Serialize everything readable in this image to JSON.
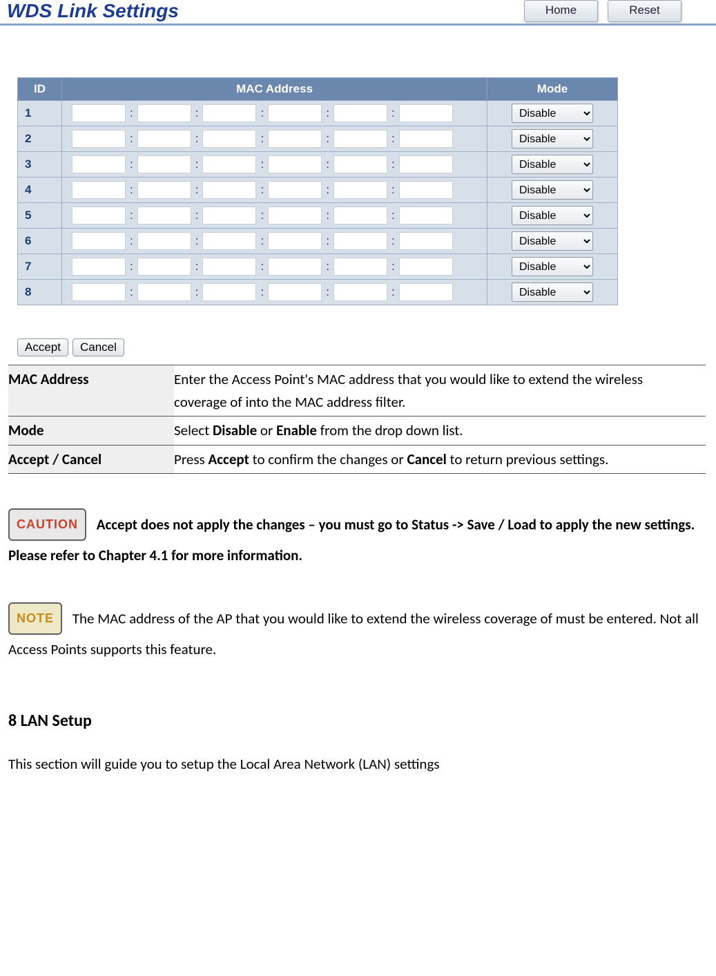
{
  "header": {
    "title": "WDS Link Settings",
    "home_btn": "Home",
    "reset_btn": "Reset"
  },
  "table": {
    "headers": {
      "id": "ID",
      "mac": "MAC Address",
      "mode": "Mode"
    },
    "rows": [
      {
        "id": "1",
        "mode": "Disable"
      },
      {
        "id": "2",
        "mode": "Disable"
      },
      {
        "id": "3",
        "mode": "Disable"
      },
      {
        "id": "4",
        "mode": "Disable"
      },
      {
        "id": "5",
        "mode": "Disable"
      },
      {
        "id": "6",
        "mode": "Disable"
      },
      {
        "id": "7",
        "mode": "Disable"
      },
      {
        "id": "8",
        "mode": "Disable"
      }
    ],
    "mac_sep": ":"
  },
  "actions": {
    "accept": "Accept",
    "cancel": "Cancel"
  },
  "descriptions": {
    "mac_label": "MAC Address",
    "mac_text": "Enter the Access Point's MAC address that you would like to extend the wireless coverage of into the MAC address filter.",
    "mode_label": "Mode",
    "mode_text_pre": "Select ",
    "mode_disable": "Disable",
    "mode_or": " or ",
    "mode_enable": "Enable",
    "mode_text_post": " from the drop down list.",
    "ac_label": "Accept / Cancel",
    "ac_pre": "Press ",
    "ac_accept": "Accept",
    "ac_mid": " to confirm the changes or ",
    "ac_cancel": "Cancel",
    "ac_post": " to return previous settings."
  },
  "caution": {
    "badge": "CAUTION",
    "text": "Accept does not apply the changes – you must go to Status -> Save / Load to apply the new settings. Please refer to Chapter 4.1 for more information."
  },
  "note": {
    "badge": "NOTE",
    "text": "The MAC address of the AP that you would like to extend the wireless coverage of must be entered. Not all Access Points supports this feature."
  },
  "section": {
    "heading": "8 LAN Setup",
    "intro": "This section will guide you to setup the Local Area Network (LAN) settings"
  }
}
